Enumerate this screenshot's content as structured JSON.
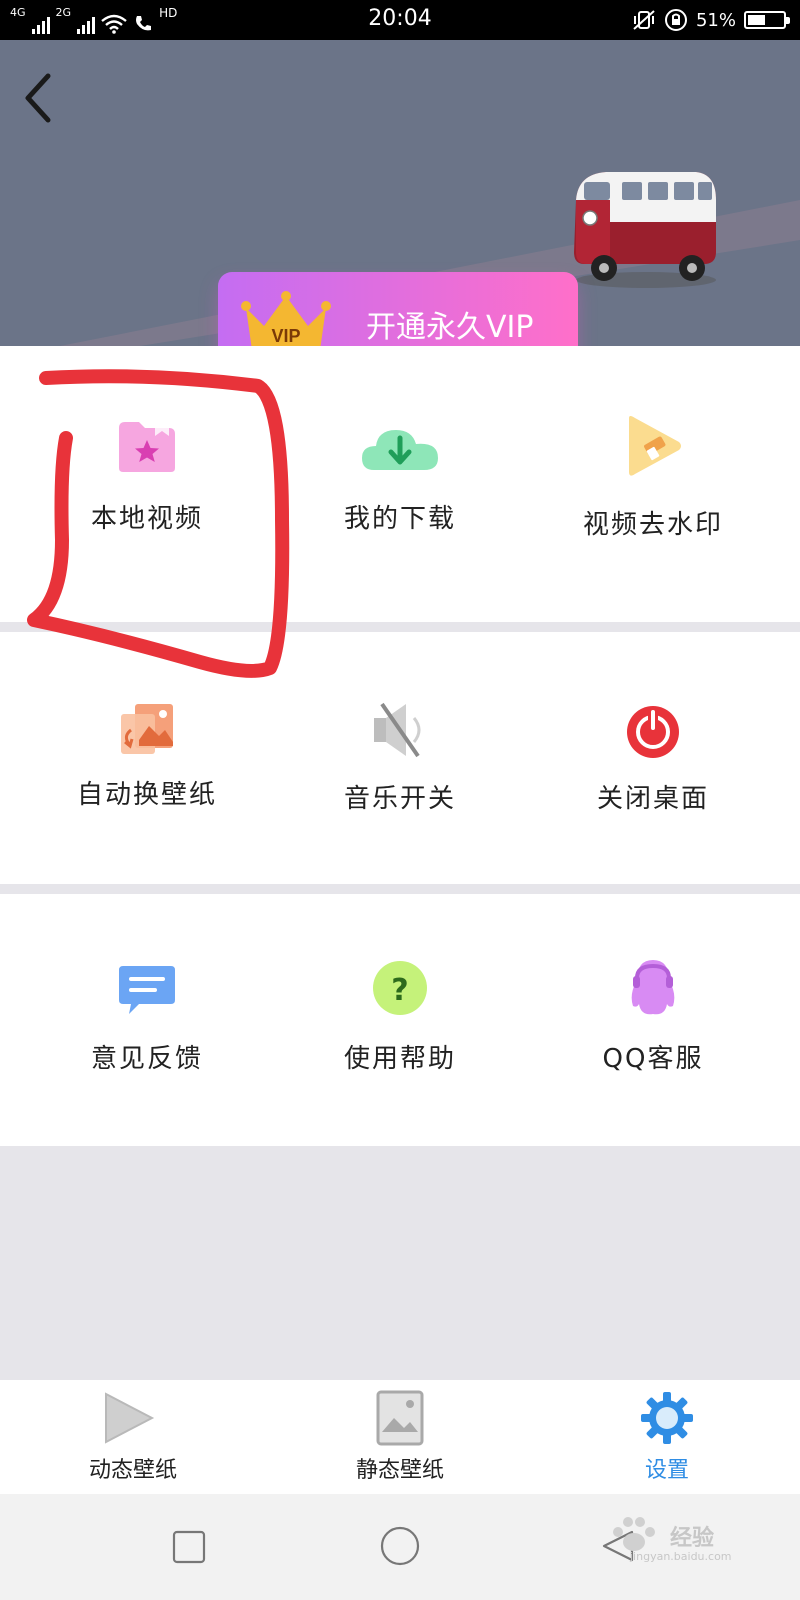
{
  "status_bar": {
    "network_1": "4G",
    "network_2": "2G",
    "hd_label": "HD",
    "time": "20:04",
    "battery_percent": "51%",
    "battery_level": 0.51
  },
  "header": {
    "back_icon": "chevron-left-icon",
    "illustration": "van-illustration",
    "vip_button_label": "开通永久VIP",
    "crown_label": "VIP"
  },
  "sections": [
    {
      "items": [
        {
          "label": "本地视频",
          "icon": "folder-star-icon"
        },
        {
          "label": "我的下载",
          "icon": "cloud-download-icon"
        },
        {
          "label": "视频去水印",
          "icon": "play-eraser-icon"
        }
      ]
    },
    {
      "items": [
        {
          "label": "自动换壁纸",
          "icon": "image-swap-icon"
        },
        {
          "label": "音乐开关",
          "icon": "speaker-muted-icon"
        },
        {
          "label": "关闭桌面",
          "icon": "power-icon"
        }
      ]
    },
    {
      "items": [
        {
          "label": "意见反馈",
          "icon": "chat-bubble-icon"
        },
        {
          "label": "使用帮助",
          "icon": "question-circle-icon"
        },
        {
          "label": "QQ客服",
          "icon": "qq-penguin-icon"
        }
      ]
    }
  ],
  "bottom_nav": {
    "tabs": [
      {
        "label": "动态壁纸",
        "icon": "play-icon",
        "active": false
      },
      {
        "label": "静态壁纸",
        "icon": "image-icon",
        "active": false
      },
      {
        "label": "设置",
        "icon": "gear-icon",
        "active": true
      }
    ]
  },
  "watermark": {
    "text": "经验",
    "url": "jingyan.baidu.com"
  },
  "colors": {
    "header_bg": "#6b7488",
    "vip_gradient_start": "#c46df2",
    "vip_gradient_end": "#ff6fc9",
    "active_tab": "#2f8de4",
    "annotation_red": "#e8333a"
  }
}
